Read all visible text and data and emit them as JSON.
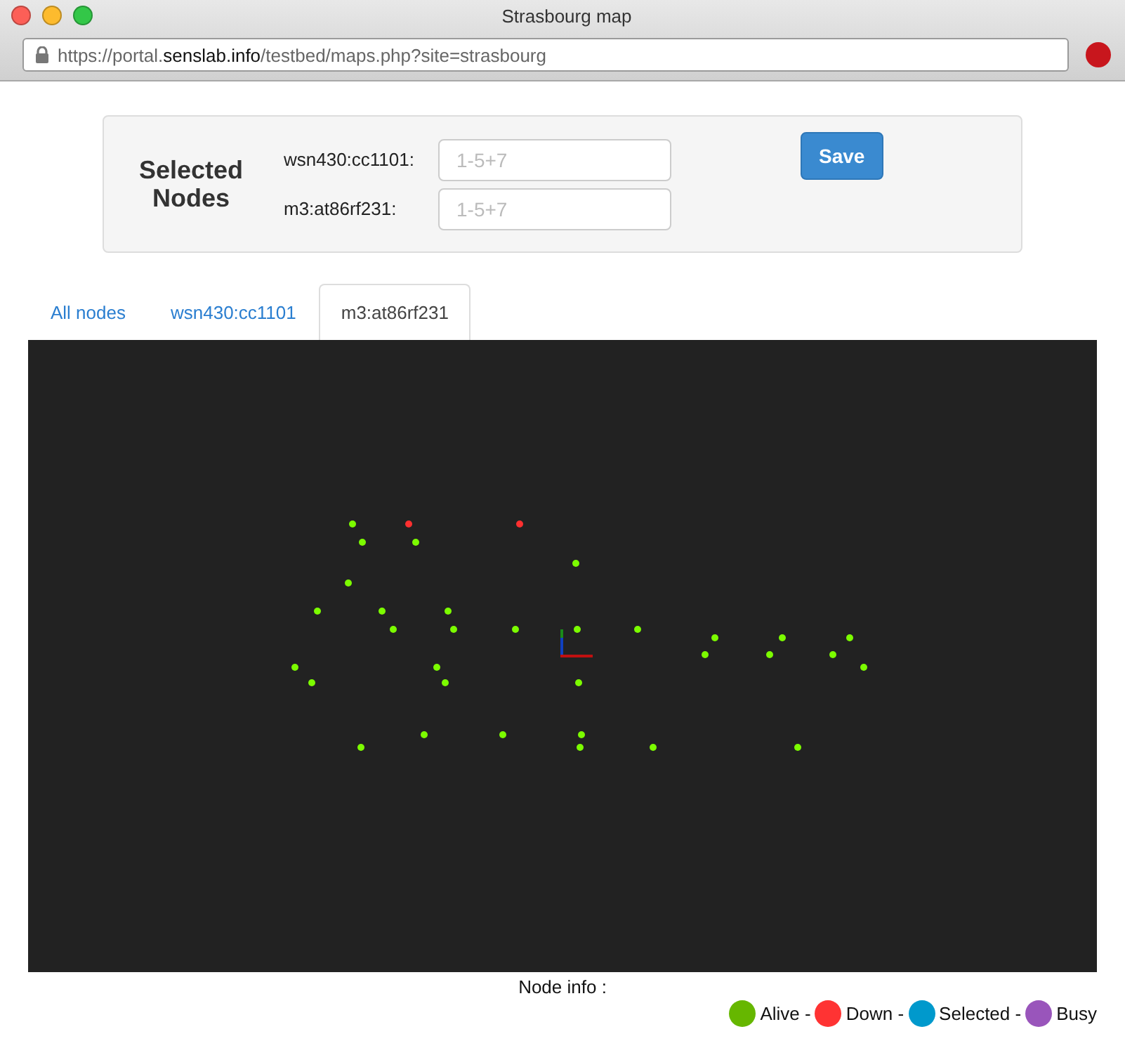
{
  "window": {
    "title": "Strasbourg map"
  },
  "address_bar": {
    "url": "https://portal.**senslab.info**/testbed/maps.php?site=strasbourg"
  },
  "selection_form": {
    "heading": "Selected Nodes",
    "fields": [
      {
        "label": "wsn430:cc1101:",
        "placeholder": "1-5+7"
      },
      {
        "label": "m3:at86rf231:",
        "placeholder": "1-5+7"
      }
    ],
    "save_button": "Save"
  },
  "tabs": [
    {
      "label": "All nodes",
      "selected": false
    },
    {
      "label": "wsn430:cc1101",
      "selected": false
    },
    {
      "label": "m3:at86rf231",
      "selected": true
    }
  ],
  "map": {
    "nodes": [
      {
        "color": "#7cfc00"
      },
      {
        "color": "#ff3030"
      },
      {
        "color": "#ff3030"
      },
      {
        "color": "#7cfc00"
      },
      {
        "color": "#7cfc00"
      },
      {
        "color": "#7cfc00"
      },
      {
        "color": "#7cfc00"
      },
      {
        "color": "#7cfc00"
      },
      {
        "color": "#7cfc00"
      },
      {
        "color": "#7cfc00"
      },
      {
        "color": "#7cfc00"
      },
      {
        "color": "#7cfc00"
      },
      {
        "color": "#7cfc00"
      },
      {
        "color": "#7cfc00"
      },
      {
        "color": "#7cfc00"
      },
      {
        "color": "#7cfc00"
      },
      {
        "color": "#7cfc00"
      },
      {
        "color": "#7cfc00"
      },
      {
        "color": "#7cfc00"
      },
      {
        "color": "#7cfc00"
      },
      {
        "color": "#7cfc00"
      },
      {
        "color": "#7cfc00"
      },
      {
        "color": "#7cfc00"
      },
      {
        "color": "#7cfc00"
      },
      {
        "color": "#7cfc00"
      },
      {
        "color": "#7cfc00"
      },
      {
        "color": "#7cfc00"
      },
      {
        "color": "#7cfc00"
      },
      {
        "color": "#7cfc00"
      },
      {
        "color": "#7cfc00"
      },
      {
        "color": "#7cfc00"
      },
      {
        "color": "#7cfc00"
      },
      {
        "color": "#7cfc00"
      },
      {
        "color": "#7cfc00"
      }
    ]
  },
  "legend": {
    "title": "Node info :",
    "items": [
      {
        "label": "Alive -",
        "color": "#66b700"
      },
      {
        "label": "Down -",
        "color": "#ff3333"
      },
      {
        "label": "Selected -",
        "color": "#0099cc"
      },
      {
        "label": "Busy",
        "color": "#9955bb"
      }
    ]
  }
}
